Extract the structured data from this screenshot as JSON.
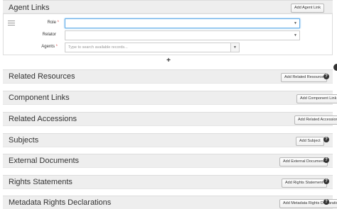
{
  "sections": [
    {
      "key": "agent_links",
      "title": "Agent Links",
      "button": "Add Agent Link"
    },
    {
      "key": "related_resources",
      "title": "Related Resources",
      "button": "Add Related Resource"
    },
    {
      "key": "component_links",
      "title": "Component Links",
      "button": "Add Component Link"
    },
    {
      "key": "related_accessions",
      "title": "Related Accessions",
      "button": "Add Related Accession"
    },
    {
      "key": "subjects",
      "title": "Subjects",
      "button": "Add Subject"
    },
    {
      "key": "external_documents",
      "title": "External Documents",
      "button": "Add External Document"
    },
    {
      "key": "rights_statements",
      "title": "Rights Statements",
      "button": "Add Rights Statement"
    },
    {
      "key": "metadata_rights",
      "title": "Metadata Rights Declarations",
      "button": "Add Metadata Rights Declaration"
    }
  ],
  "agent_form": {
    "role_label": "Role",
    "relator_label": "Relator",
    "agents_label": "Agents",
    "required_marker": "*",
    "agents_placeholder": "Type to search available records...",
    "role_value": "",
    "relator_value": ""
  },
  "add_row_symbol": "+",
  "help_symbol": "?"
}
